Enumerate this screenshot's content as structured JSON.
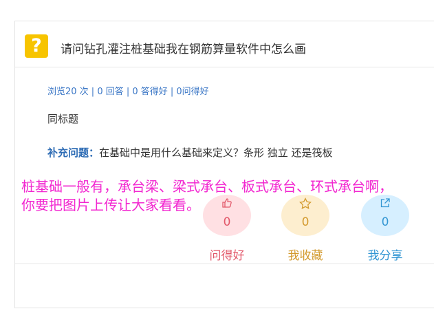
{
  "question": {
    "icon": "question-mark-icon",
    "title": "请问钻孔灌注桩基础我在钢筋算量软件中怎么画"
  },
  "stats": "浏览20 次 | 0 回答 | 0 答得好 | 0问得好",
  "description": "同标题",
  "supplement": {
    "label": "补充问题：",
    "text": "在基础中是用什么基础来定义？条形  独立  还是筏板"
  },
  "actions": [
    {
      "icon": "thumbs-up-icon",
      "count": "0",
      "label": "问得好",
      "color": "#e2586a"
    },
    {
      "icon": "star-icon",
      "count": "0",
      "label": "我收藏",
      "color": "#d39a2e"
    },
    {
      "icon": "share-icon",
      "count": "0",
      "label": "我分享",
      "color": "#3396d3"
    }
  ],
  "overlay_text": "桩基础一般有，承台梁、梁式承台、板式承台、环式承台啊，\n你要把图片上传让大家看看。",
  "colors": {
    "overlay": "#f227d0",
    "link": "#3b77c6",
    "question_icon_bg": "#f7c400"
  }
}
